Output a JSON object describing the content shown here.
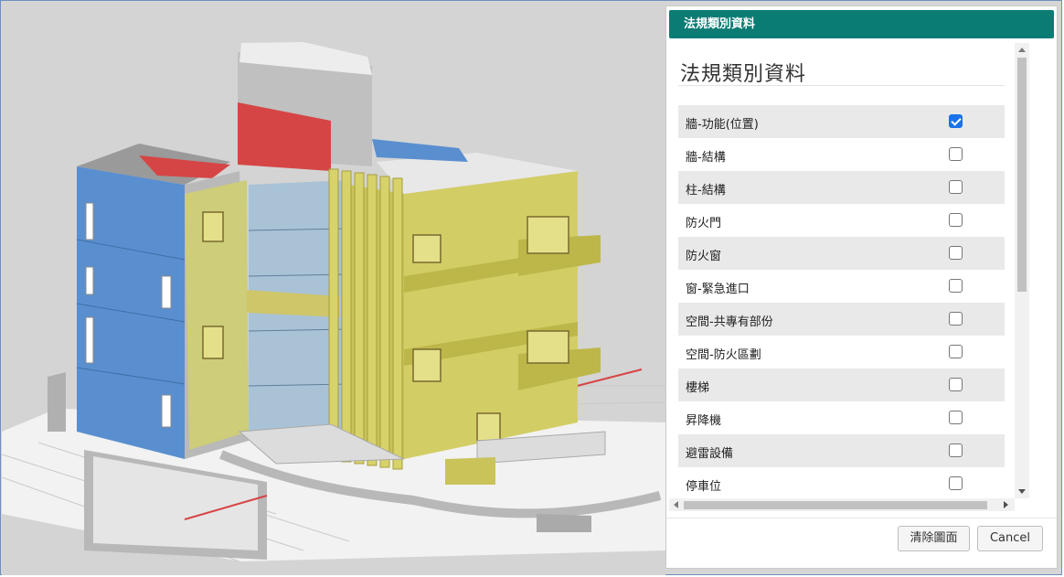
{
  "dialog": {
    "header_title": "法規類別資料",
    "panel_title": "法規類別資料",
    "items": [
      {
        "label": "牆-功能(位置)",
        "checked": true
      },
      {
        "label": "牆-結構",
        "checked": false
      },
      {
        "label": "柱-結構",
        "checked": false
      },
      {
        "label": "防火門",
        "checked": false
      },
      {
        "label": "防火窗",
        "checked": false
      },
      {
        "label": "窗-緊急進口",
        "checked": false
      },
      {
        "label": "空間-共專有部份",
        "checked": false
      },
      {
        "label": "空間-防火區劃",
        "checked": false
      },
      {
        "label": "樓梯",
        "checked": false
      },
      {
        "label": "昇降機",
        "checked": false
      },
      {
        "label": "避雷設備",
        "checked": false
      },
      {
        "label": "停車位",
        "checked": false
      }
    ],
    "buttons": {
      "clear_label": "清除圖面",
      "cancel_label": "Cancel"
    }
  },
  "colors": {
    "header": "#0b7c73",
    "wall_blue": "#4f86c6",
    "wall_yellow": "#c9c35a",
    "wall_red": "#d64545",
    "checkbox_checked": "#1a73e8"
  }
}
